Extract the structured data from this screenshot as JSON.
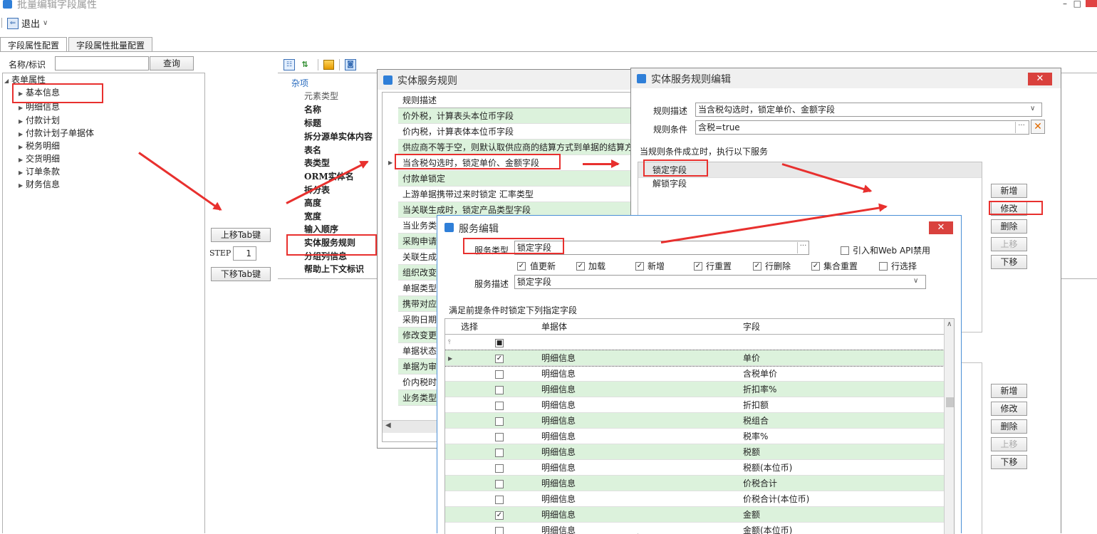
{
  "window": {
    "title": "批量编辑字段属性"
  },
  "toolbar": {
    "exit_label": "退出",
    "exit_caret": "∨"
  },
  "tabs": [
    "字段属性配置",
    "字段属性批量配置"
  ],
  "search": {
    "label": "名称/标识",
    "value": "",
    "query_button": "查询"
  },
  "tree": {
    "root": "表单属性",
    "items": [
      "基本信息",
      "明细信息",
      "付款计划",
      "付款计划子单据体",
      "税务明细",
      "交货明细",
      "订单条款",
      "财务信息"
    ]
  },
  "tab_controls": {
    "move_up": "上移Tab键",
    "step_label": "STEP",
    "step_value": "1",
    "move_down": "下移Tab键"
  },
  "props": {
    "category": "杂项",
    "rows": [
      "元素类型",
      "名称",
      "标题",
      "拆分源单实体内容",
      "表名",
      "表类型",
      "ORM实体名",
      "拆分表",
      "高度",
      "宽度",
      "输入顺序",
      "实体服务规则",
      "分组列信息",
      "帮助上下文标识"
    ]
  },
  "rules_dialog": {
    "title": "实体服务规则",
    "header": "规则描述",
    "rows": [
      "价外税，计算表头本位币字段",
      "价内税，计算表体本位币字段",
      "供应商不等于空，则默认取供应商的结算方式到单据的结算方式",
      "当含税勾选时，锁定单价、金额字段",
      "付款单锁定",
      "上游单据携带过来时锁定 汇率类型",
      "当关联生成时，锁定产品类型字段",
      "当业务类型",
      "采购申请下",
      "关联生成",
      "组织改变",
      "单据类型",
      "携带对应组",
      "采购日期",
      "修改变更",
      "单据状态",
      "单据为审核",
      "价内税时",
      "业务类型"
    ]
  },
  "rule_edit_dialog": {
    "title": "实体服务规则编辑",
    "desc_label": "规则描述",
    "desc_value": "当含税勾选时，锁定单价、金额字段",
    "cond_label": "规则条件",
    "cond_value": "含税=true",
    "section_label": "当规则条件成立时，执行以下服务",
    "services": [
      "锁定字段",
      "解锁字段"
    ],
    "buttons_top": [
      "新增",
      "修改",
      "删除",
      "上移",
      "下移"
    ],
    "buttons_bottom": [
      "新增",
      "修改",
      "删除",
      "上移",
      "下移"
    ]
  },
  "service_dialog": {
    "title": "服务编辑",
    "type_label": "服务类型",
    "type_value": "锁定字段",
    "webapi_label": "引入和Web API禁用",
    "checks": [
      {
        "label": "值更新",
        "checked": true
      },
      {
        "label": "加载",
        "checked": true
      },
      {
        "label": "新增",
        "checked": true
      },
      {
        "label": "行重置",
        "checked": true
      },
      {
        "label": "行删除",
        "checked": true
      },
      {
        "label": "集合重置",
        "checked": true
      },
      {
        "label": "行选择",
        "checked": false
      }
    ],
    "desc_label": "服务描述",
    "desc_value": "锁定字段",
    "section_label": "满足前提条件时锁定下列指定字段",
    "grid_headers": [
      "选择",
      "单据体",
      "字段"
    ],
    "rows": [
      {
        "entity": "明细信息",
        "field": "单价",
        "checked": true
      },
      {
        "entity": "明细信息",
        "field": "含税单价",
        "checked": false
      },
      {
        "entity": "明细信息",
        "field": "折扣率%",
        "checked": false
      },
      {
        "entity": "明细信息",
        "field": "折扣额",
        "checked": false
      },
      {
        "entity": "明细信息",
        "field": "税组合",
        "checked": false
      },
      {
        "entity": "明细信息",
        "field": "税率%",
        "checked": false
      },
      {
        "entity": "明细信息",
        "field": "税额",
        "checked": false
      },
      {
        "entity": "明细信息",
        "field": "税额(本位币)",
        "checked": false
      },
      {
        "entity": "明细信息",
        "field": "价税合计",
        "checked": false
      },
      {
        "entity": "明细信息",
        "field": "价税合计(本位币)",
        "checked": false
      },
      {
        "entity": "明细信息",
        "field": "金额",
        "checked": true
      },
      {
        "entity": "明细信息",
        "field": "金额(本位币)",
        "checked": false
      }
    ]
  },
  "colors": {
    "highlight_red": "#e8302e",
    "row_green": "#dcf2dc",
    "close_red": "#d9413d"
  }
}
